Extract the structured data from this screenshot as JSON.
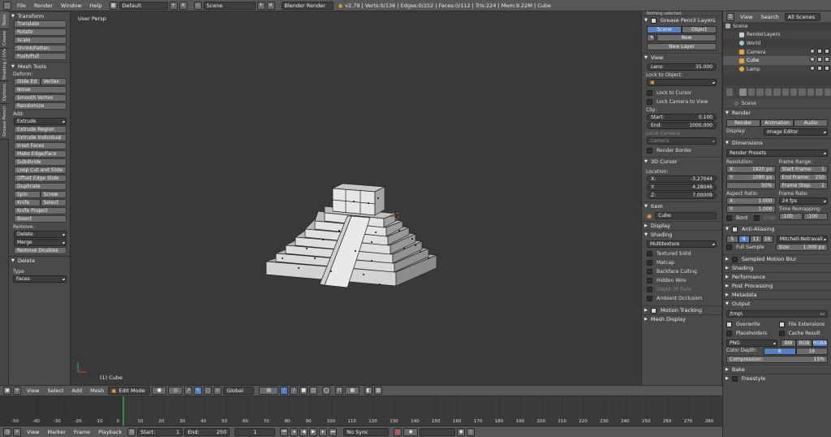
{
  "topbar": {
    "menus": [
      "File",
      "Render",
      "Window",
      "Help"
    ],
    "screen_layout": "Default",
    "scene": "Scene",
    "render_engine": "Blender Render",
    "stats": "v2.79 | Verts:0/136 | Edges:0/252 | Faces:0/112 | Tris:224 | Mem:9.22M | Cube"
  },
  "tool_tabs": [
    "Tools",
    "Create",
    "Shading / UVs",
    "Options",
    "Grease Pencil"
  ],
  "toolshelf": {
    "transform": {
      "title": "Transform",
      "buttons": [
        "Translate",
        "Rotate",
        "Scale",
        "Shrink/Fatten",
        "Push/Pull"
      ]
    },
    "mesh_tools": {
      "title": "Mesh Tools",
      "deform_label": "Deform:",
      "slide_edge": "Slide Ed",
      "vertex": "Vertex",
      "noise": "Noise",
      "smooth_vertex": "Smooth Vertex",
      "randomize": "Randomize",
      "add_label": "Add:",
      "extrude": "Extrude",
      "add_buttons": [
        "Extrude Region",
        "Extrude Individual",
        "Inset Faces",
        "Make Edge/Face",
        "Subdivide",
        "Loop Cut and Slide",
        "Offset Edge Slide",
        "Duplicate"
      ],
      "spin": "Spin",
      "screw": "Screw",
      "knife": "Knife",
      "select": "Select",
      "knife_project": "Knife Project",
      "bisect": "Bisect",
      "remove_label": "Remove:",
      "delete": "Delete",
      "merge": "Merge",
      "remove_doubles": "Remove Doubles"
    },
    "operator": {
      "title": "Delete",
      "type_label": "Type",
      "type_value": "Faces"
    }
  },
  "viewport": {
    "label": "User Persp",
    "object_label": "(1) Cube"
  },
  "npanel": {
    "top_text": "Nothing selected",
    "grease_pencil": {
      "title": "Grease Pencil Layers",
      "scene_tab": "Scene",
      "object_tab": "Object",
      "new_btn": "New",
      "new_layer": "New Layer"
    },
    "view": {
      "title": "View",
      "lens_label": "Lens:",
      "lens_value": "35.000",
      "lock_to_object": "Lock to Object:",
      "lock_to_cursor": "Lock to Cursor",
      "lock_camera": "Lock Camera to View",
      "clip_label": "Clip:",
      "clip_start_label": "Start:",
      "clip_start": "0.100",
      "clip_end_label": "End:",
      "clip_end": "1000.000",
      "local_camera": "Local Camera:",
      "camera": "Camera",
      "render_border": "Render Border"
    },
    "cursor": {
      "title": "3D Cursor",
      "location": "Location:",
      "x_label": "X:",
      "x": "-3.27044",
      "y_label": "Y:",
      "y": "4.28046",
      "z_label": "Z:",
      "z": "7.00009"
    },
    "item": {
      "title": "Item",
      "name": "Cube"
    },
    "display_title": "Display",
    "shading": {
      "title": "Shading",
      "mode": "Multitexture",
      "options": [
        "Textured Solid",
        "Matcap",
        "Backface Culling",
        "Hidden Wire",
        "Depth Of Field",
        "Ambient Occlusion"
      ]
    },
    "motion_tracking": "Motion Tracking",
    "mesh_display": "Mesh Display"
  },
  "outliner": {
    "menus": [
      "View",
      "Search"
    ],
    "filter": "All Scenes",
    "rows": [
      "Scene",
      "RenderLayers",
      "World",
      "Camera",
      "Cube",
      "Lamp"
    ]
  },
  "properties": {
    "scene_name": "Scene",
    "render": {
      "title": "Render",
      "render_btn": "Render",
      "animation_btn": "Animation",
      "audio_btn": "Audio",
      "display_label": "Display:",
      "display_value": "Image Editor"
    },
    "dimensions": {
      "title": "Dimensions",
      "presets": "Render Presets",
      "resolution_label": "Resolution:",
      "res_x_label": "X:",
      "res_x": "1920 px",
      "res_y_label": "Y:",
      "res_y": "1080 px",
      "res_pct": "50%",
      "frame_range_label": "Frame Range:",
      "start_label": "Start Frame:",
      "start": "1",
      "end_label": "End Frame:",
      "end": "250",
      "step_label": "Frame Step:",
      "step": "1",
      "aspect_label": "Aspect Ratio:",
      "asp_x_label": "X:",
      "asp_x": "1.000",
      "asp_y_label": "Y:",
      "asp_y": "1.000",
      "frame_rate_label": "Frame Rate:",
      "frame_rate": "24 fps",
      "time_remap": "Time Remapping:",
      "remap_old": ":100",
      "remap_new": ":100",
      "bord": "Bord",
      "crop": "Crop"
    },
    "anti_aliasing": {
      "title": "Anti-Aliasing",
      "samples": [
        "5",
        "8",
        "11",
        "16"
      ],
      "filter": "Mitchell-Netravali",
      "full_sample": "Full Sample",
      "size_label": "Size:",
      "size": "1.000 px"
    },
    "collapsed": [
      "Sampled Motion Blur",
      "Shading",
      "Performance",
      "Post Processing",
      "Metadata"
    ],
    "output": {
      "title": "Output",
      "path": "/tmp\\",
      "overwrite": "Overwrite",
      "file_extensions": "File Extensions",
      "placeholders": "Placeholders",
      "cache_result": "Cache Result",
      "format": "PNG",
      "bw": "BW",
      "rgb": "RGB",
      "rgba": "RGBA",
      "color_depth_label": "Color Depth:",
      "depth_8": "8",
      "depth_16": "16",
      "compression_label": "Compression:",
      "compression": "15%"
    },
    "bake": "Bake",
    "freestyle": "Freestyle"
  },
  "viewport_header": {
    "menus": [
      "View",
      "Select",
      "Add",
      "Mesh"
    ],
    "mode": "Edit Mode",
    "orientation": "Global"
  },
  "timeline": {
    "ticks": [
      "-50",
      "-40",
      "-30",
      "-20",
      "-10",
      "0",
      "10",
      "20",
      "30",
      "40",
      "50",
      "60",
      "70",
      "80",
      "90",
      "100",
      "110",
      "120",
      "130",
      "140",
      "150",
      "160",
      "170",
      "180",
      "190",
      "200",
      "210",
      "220",
      "230",
      "240",
      "250",
      "260",
      "270",
      "280"
    ],
    "current_frame": "1",
    "menus": [
      "View",
      "Marker",
      "Frame",
      "Playback"
    ],
    "start_label": "Start:",
    "start": "1",
    "end_label": "End:",
    "end": "250",
    "sync": "No Sync"
  }
}
